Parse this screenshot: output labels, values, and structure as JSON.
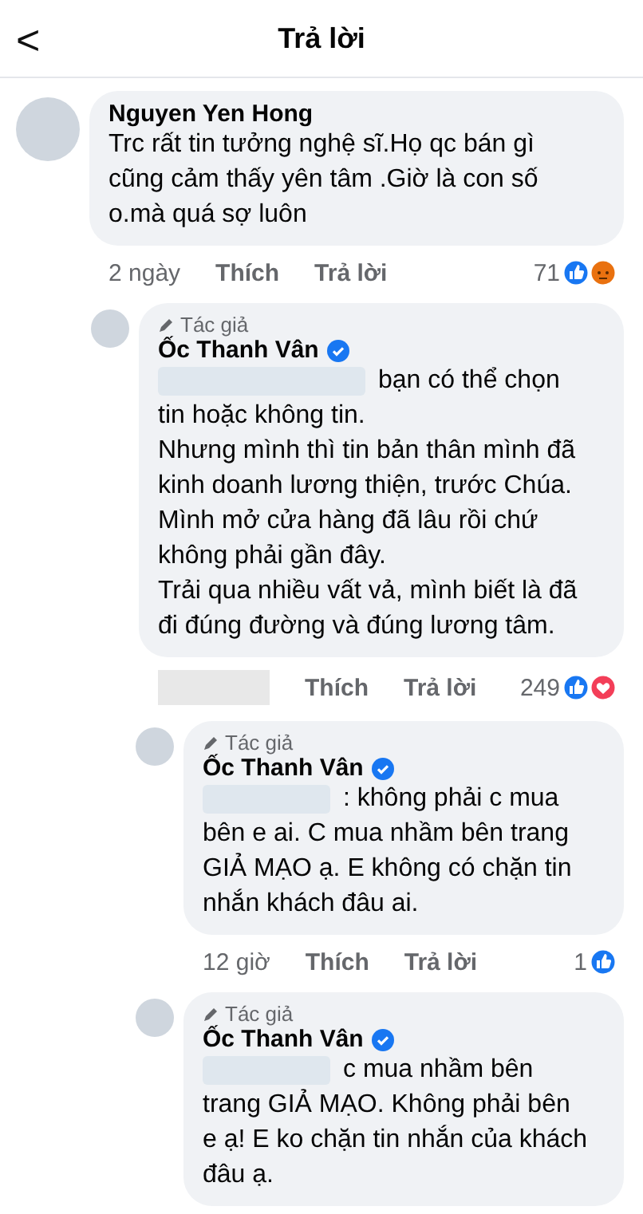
{
  "header": {
    "back": "<",
    "title": "Trả lời"
  },
  "comment": {
    "name": "Nguyen Yen Hong",
    "text": "Trc rất tin tưởng nghệ sĩ.Họ qc bán gì\ncũng cảm thấy yên tâm .Giờ là con số\no.mà quá sợ luôn",
    "time": "2 ngày",
    "like": "Thích",
    "reply": "Trả lời",
    "count": "71",
    "reactions": {
      "like": true,
      "angry": true
    },
    "replies": [
      {
        "author_label": "Tác giả",
        "name": "Ốc Thanh Vân",
        "verified": true,
        "mention_hidden": true,
        "lead": "bạn có thể chọn",
        "text": "tin hoặc không tin.\nNhưng mình thì tin bản thân mình đã\nkinh doanh lương thiện, trước Chúa.\nMình mở cửa hàng đã lâu rồi chứ\nkhông phải gần đây.\nTrải qua nhiều vất vả, mình biết là đã\nđi đúng đường và đúng lương tâm.",
        "time_hidden": true,
        "like": "Thích",
        "reply": "Trả lời",
        "count": "249",
        "reactions": {
          "like": true,
          "love": true
        },
        "replies": [
          {
            "author_label": "Tác giả",
            "name": "Ốc Thanh Vân",
            "verified": true,
            "mention_hidden": true,
            "lead": ": không phải c mua",
            "text": "bên e ai. C mua nhầm bên trang\nGIẢ MẠO ạ. E không có chặn tin\nnhắn khách đâu ai.",
            "time_hidden": false,
            "time": "12 giờ",
            "like": "Thích",
            "reply": "Trả lời",
            "count": "1",
            "reactions": {
              "like": true
            }
          },
          {
            "author_label": "Tác giả",
            "name": "Ốc Thanh Vân",
            "verified": true,
            "mention_hidden": true,
            "lead": "c mua nhầm bên",
            "text": "trang GIẢ MẠO. Không phải bên\ne ạ! E ko chặn tin nhắn của khách\nđâu ạ."
          }
        ]
      }
    ]
  }
}
